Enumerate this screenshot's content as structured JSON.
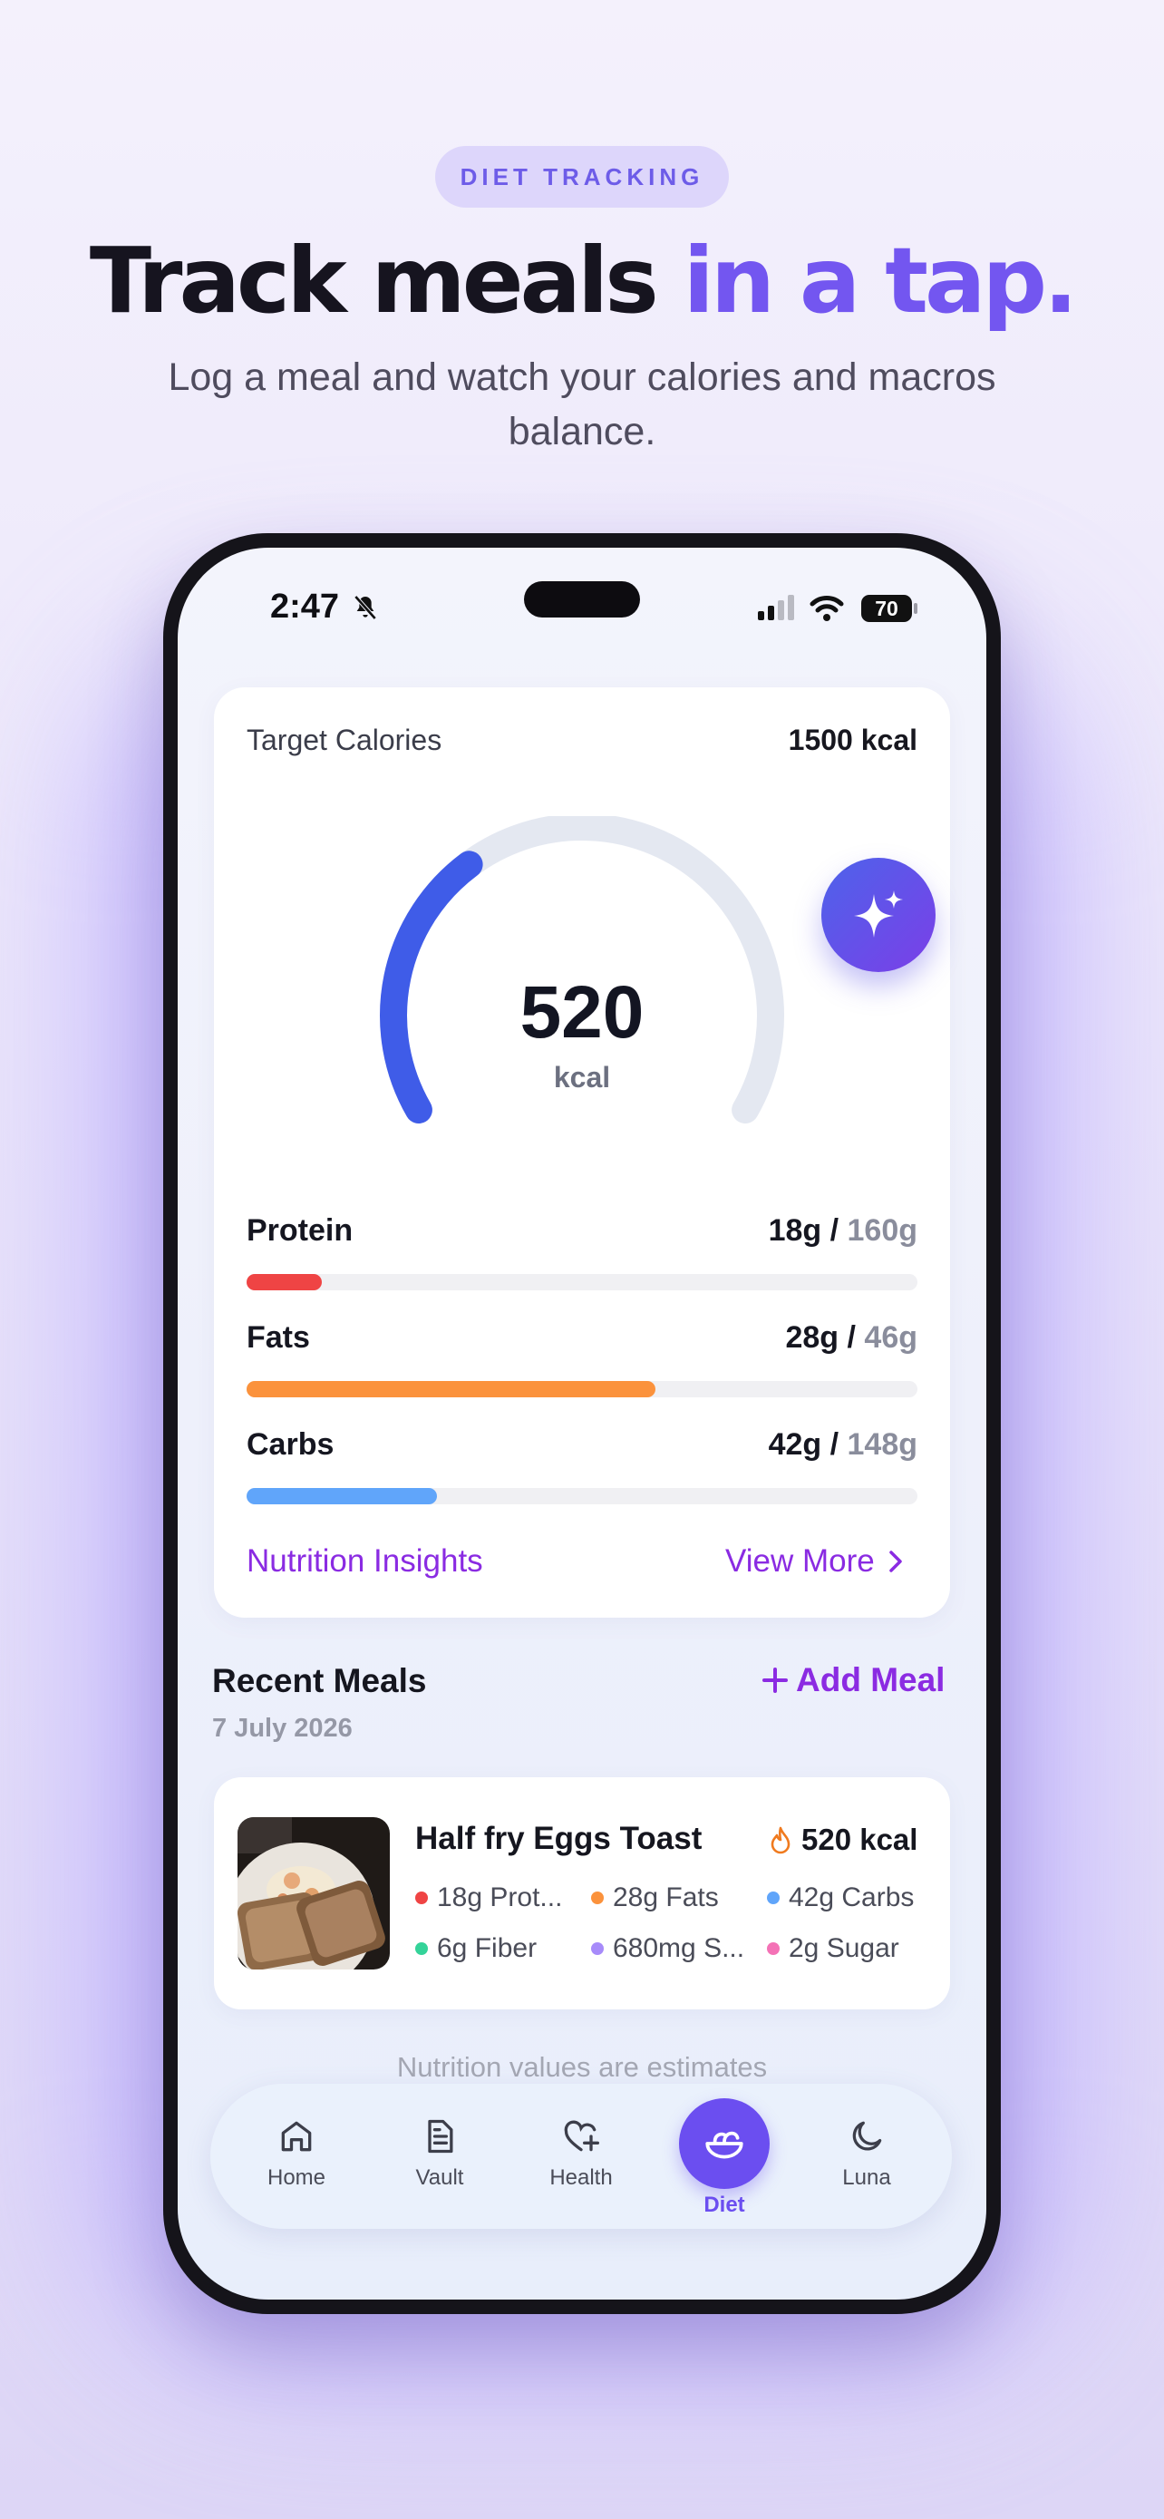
{
  "header": {
    "badge": "DIET TRACKING",
    "headline_part1": "Track meals ",
    "headline_accent": "in a tap.",
    "subtitle": "Log a meal and watch your calories and macros balance."
  },
  "status_bar": {
    "time": "2:47",
    "battery": "70"
  },
  "calorie_card": {
    "label": "Target Calories",
    "target": "1500 kcal",
    "consumed": "520",
    "unit": "kcal",
    "gauge_fraction": 0.347,
    "colors": {
      "gauge": "#3f5ce8",
      "gauge_track": "#e4e8f1"
    }
  },
  "macros": [
    {
      "name": "Protein",
      "current": "18g",
      "sep": " / ",
      "target": "160g",
      "fraction": 0.1125,
      "color": "#ef4444"
    },
    {
      "name": "Fats",
      "current": "28g",
      "sep": " / ",
      "target": "46g",
      "fraction": 0.609,
      "color": "#fb923c"
    },
    {
      "name": "Carbs",
      "current": "42g",
      "sep": " / ",
      "target": "148g",
      "fraction": 0.284,
      "color": "#60a5fa"
    }
  ],
  "insights": {
    "label": "Nutrition Insights",
    "view_more": "View More"
  },
  "recent_meals": {
    "title": "Recent Meals",
    "date": "7 July 2026",
    "add_label": "Add Meal",
    "items": [
      {
        "name": "Half fry Eggs Toast",
        "kcal": "520 kcal",
        "nutrients": [
          {
            "text": "18g Prot...",
            "color": "#ef4444"
          },
          {
            "text": "28g Fats",
            "color": "#fb923c"
          },
          {
            "text": "42g Carbs",
            "color": "#60a5fa"
          },
          {
            "text": "6g Fiber",
            "color": "#34d399"
          },
          {
            "text": "680mg S...",
            "color": "#a78bfa"
          },
          {
            "text": "2g Sugar",
            "color": "#f472b6"
          }
        ]
      }
    ]
  },
  "disclaimer": "Nutrition values are estimates",
  "tabs": [
    {
      "label": "Home",
      "icon": "home-icon"
    },
    {
      "label": "Vault",
      "icon": "document-icon"
    },
    {
      "label": "Health",
      "icon": "heart-plus-icon"
    },
    {
      "label": "Diet",
      "icon": "salad-bowl-icon",
      "active": true
    },
    {
      "label": "Luna",
      "icon": "moon-icon"
    }
  ],
  "colors": {
    "accent": "#7356f0",
    "link": "#8a2be2",
    "active_tab": "#6b4ef0"
  }
}
